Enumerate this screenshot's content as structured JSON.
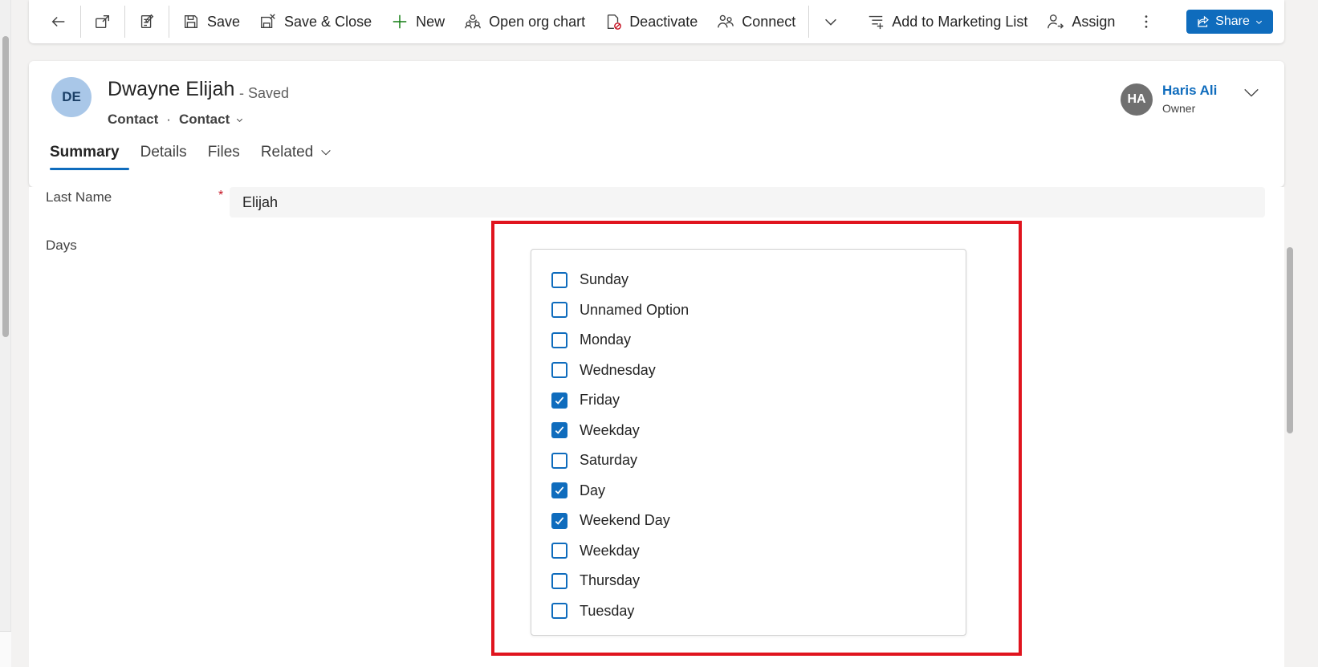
{
  "command_bar": {
    "save": "Save",
    "save_close": "Save & Close",
    "new": "New",
    "open_org_chart": "Open org chart",
    "deactivate": "Deactivate",
    "connect": "Connect",
    "add_to_marketing_list": "Add to Marketing List",
    "assign": "Assign",
    "share": "Share"
  },
  "record": {
    "initials": "DE",
    "name": "Dwayne Elijah",
    "status": "- Saved",
    "entity": "Contact",
    "form": "Contact"
  },
  "owner": {
    "initials": "HA",
    "name": "Haris Ali",
    "role": "Owner"
  },
  "tabs": [
    {
      "label": "Summary",
      "active": true
    },
    {
      "label": "Details",
      "active": false
    },
    {
      "label": "Files",
      "active": false
    },
    {
      "label": "Related",
      "active": false
    }
  ],
  "fields": {
    "last_name_label": "Last Name",
    "last_name_required": "*",
    "last_name_value": "Elijah",
    "days_label": "Days"
  },
  "days_options": [
    {
      "label": "Sunday",
      "checked": false
    },
    {
      "label": "Unnamed Option",
      "checked": false
    },
    {
      "label": "Monday",
      "checked": false
    },
    {
      "label": "Wednesday",
      "checked": false
    },
    {
      "label": "Friday",
      "checked": true
    },
    {
      "label": "Weekday",
      "checked": true
    },
    {
      "label": "Saturday",
      "checked": false
    },
    {
      "label": "Day",
      "checked": true
    },
    {
      "label": "Weekend Day",
      "checked": true
    },
    {
      "label": "Weekday",
      "checked": false
    },
    {
      "label": "Thursday",
      "checked": false
    },
    {
      "label": "Tuesday",
      "checked": false
    }
  ],
  "colors": {
    "accent": "#0f6cbd",
    "highlight": "#e0141e",
    "avatar_de": "#a9c7e8",
    "avatar_ha": "#707070"
  }
}
